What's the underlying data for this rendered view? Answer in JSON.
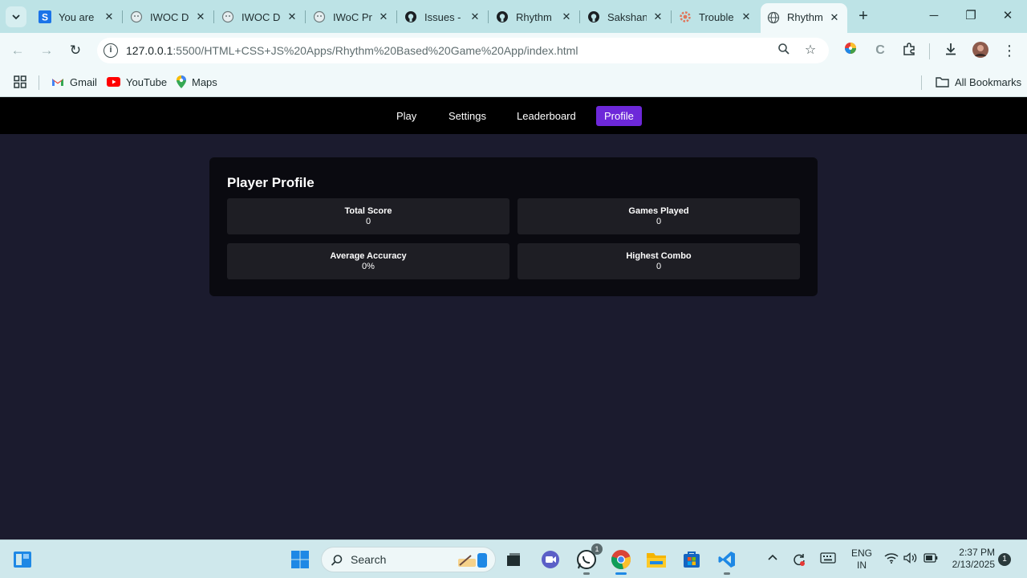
{
  "browser": {
    "tabs": [
      {
        "title": "You are",
        "icon": "s-icon"
      },
      {
        "title": "IWOC D",
        "icon": "globe-icon"
      },
      {
        "title": "IWOC D",
        "icon": "globe-icon"
      },
      {
        "title": "IWoC Pr",
        "icon": "globe-icon"
      },
      {
        "title": "Issues -",
        "icon": "github-icon"
      },
      {
        "title": "Rhythm",
        "icon": "github-icon"
      },
      {
        "title": "Sakshan",
        "icon": "github-icon"
      },
      {
        "title": "Trouble",
        "icon": "settings-icon"
      },
      {
        "title": "Rhythm",
        "icon": "globe-icon"
      }
    ],
    "url_host": "127.0.0.1",
    "url_rest": ":5500/HTML+CSS+JS%20Apps/Rhythm%20Based%20Game%20App/index.html",
    "bookmarks": {
      "gmail": "Gmail",
      "youtube": "YouTube",
      "maps": "Maps",
      "all": "All Bookmarks"
    }
  },
  "app": {
    "nav": {
      "play": "Play",
      "settings": "Settings",
      "leaderboard": "Leaderboard",
      "profile": "Profile"
    },
    "profile": {
      "title": "Player Profile",
      "stats": [
        {
          "label": "Total Score",
          "value": "0"
        },
        {
          "label": "Games Played",
          "value": "0"
        },
        {
          "label": "Average Accuracy",
          "value": "0%"
        },
        {
          "label": "Highest Combo",
          "value": "0"
        }
      ]
    }
  },
  "taskbar": {
    "search": "Search",
    "whatsapp_badge": "1",
    "lang_line1": "ENG",
    "lang_line2": "IN",
    "time": "2:37 PM",
    "date": "2/13/2025",
    "notifications": "1"
  }
}
